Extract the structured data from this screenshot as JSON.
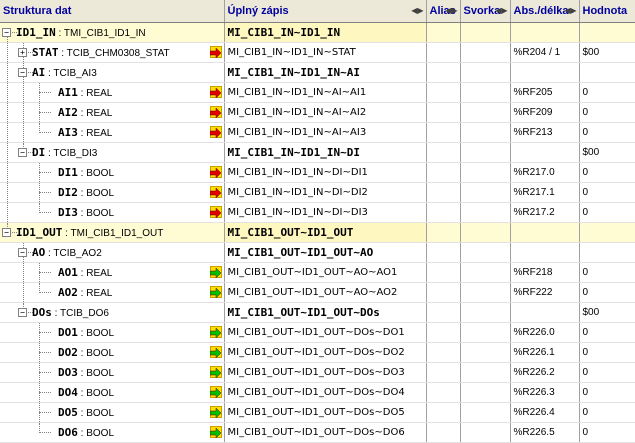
{
  "columns": {
    "structure": "Struktura dat",
    "full_path": "Úplný zápis",
    "alias": "Alias",
    "terminal": "Svorka",
    "abs_len": "Abs./délka",
    "value": "Hodnota"
  },
  "rows": [
    {
      "level": 0,
      "expander": "minus",
      "name": "ID1_IN",
      "sep": " : ",
      "type": "TMI_CIB1_ID1_IN",
      "full": "MI_CIB1_IN~ID1_IN",
      "bold": true,
      "highlight": true,
      "pin": "",
      "abs": "",
      "val": ""
    },
    {
      "level": 1,
      "expander": "plus",
      "name": "STAT",
      "sep": " : ",
      "type": "TCIB_CHM0308_STAT",
      "full": "MI_CIB1_IN~ID1_IN~STAT",
      "bold": false,
      "highlight": false,
      "pin": "in",
      "abs": "%R204 / 1",
      "val": "$00"
    },
    {
      "level": 1,
      "expander": "minus",
      "name": "AI",
      "sep": " : ",
      "type": "TCIB_AI3",
      "full": "MI_CIB1_IN~ID1_IN~AI",
      "bold": true,
      "highlight": false,
      "pin": "",
      "abs": "",
      "val": ""
    },
    {
      "level": 2,
      "expander": "",
      "name": "AI1",
      "sep": " : ",
      "type": "REAL",
      "full": "MI_CIB1_IN~ID1_IN~AI~AI1",
      "bold": false,
      "highlight": false,
      "pin": "in",
      "abs": "%RF205",
      "val": "0"
    },
    {
      "level": 2,
      "expander": "",
      "name": "AI2",
      "sep": " : ",
      "type": "REAL",
      "full": "MI_CIB1_IN~ID1_IN~AI~AI2",
      "bold": false,
      "highlight": false,
      "pin": "in",
      "abs": "%RF209",
      "val": "0"
    },
    {
      "level": 2,
      "expander": "",
      "name": "AI3",
      "sep": " : ",
      "type": "REAL",
      "full": "MI_CIB1_IN~ID1_IN~AI~AI3",
      "bold": false,
      "highlight": false,
      "pin": "in",
      "abs": "%RF213",
      "val": "0"
    },
    {
      "level": 1,
      "expander": "minus",
      "name": "DI",
      "sep": " : ",
      "type": "TCIB_DI3",
      "full": "MI_CIB1_IN~ID1_IN~DI",
      "bold": true,
      "highlight": false,
      "pin": "",
      "abs": "",
      "val": "$00"
    },
    {
      "level": 2,
      "expander": "",
      "name": "DI1",
      "sep": " : ",
      "type": "BOOL",
      "full": "MI_CIB1_IN~ID1_IN~DI~DI1",
      "bold": false,
      "highlight": false,
      "pin": "in",
      "abs": "%R217.0",
      "val": "0"
    },
    {
      "level": 2,
      "expander": "",
      "name": "DI2",
      "sep": " : ",
      "type": "BOOL",
      "full": "MI_CIB1_IN~ID1_IN~DI~DI2",
      "bold": false,
      "highlight": false,
      "pin": "in",
      "abs": "%R217.1",
      "val": "0"
    },
    {
      "level": 2,
      "expander": "",
      "name": "DI3",
      "sep": " : ",
      "type": "BOOL",
      "full": "MI_CIB1_IN~ID1_IN~DI~DI3",
      "bold": false,
      "highlight": false,
      "pin": "in",
      "abs": "%R217.2",
      "val": "0"
    },
    {
      "level": 0,
      "expander": "minus",
      "name": "ID1_OUT",
      "sep": " : ",
      "type": "TMI_CIB1_ID1_OUT",
      "full": "MI_CIB1_OUT~ID1_OUT",
      "bold": true,
      "highlight": true,
      "pin": "",
      "abs": "",
      "val": ""
    },
    {
      "level": 1,
      "expander": "minus",
      "name": "AO",
      "sep": " : ",
      "type": "TCIB_AO2",
      "full": "MI_CIB1_OUT~ID1_OUT~AO",
      "bold": true,
      "highlight": false,
      "pin": "",
      "abs": "",
      "val": ""
    },
    {
      "level": 2,
      "expander": "",
      "name": "AO1",
      "sep": " : ",
      "type": "REAL",
      "full": "MI_CIB1_OUT~ID1_OUT~AO~AO1",
      "bold": false,
      "highlight": false,
      "pin": "out",
      "abs": "%RF218",
      "val": "0"
    },
    {
      "level": 2,
      "expander": "",
      "name": "AO2",
      "sep": " : ",
      "type": "REAL",
      "full": "MI_CIB1_OUT~ID1_OUT~AO~AO2",
      "bold": false,
      "highlight": false,
      "pin": "out",
      "abs": "%RF222",
      "val": "0"
    },
    {
      "level": 1,
      "expander": "minus",
      "name": "DOs",
      "sep": " : ",
      "type": "TCIB_DO6",
      "full": "MI_CIB1_OUT~ID1_OUT~DOs",
      "bold": true,
      "highlight": false,
      "pin": "",
      "abs": "",
      "val": "$00"
    },
    {
      "level": 2,
      "expander": "",
      "name": "DO1",
      "sep": " : ",
      "type": "BOOL",
      "full": "MI_CIB1_OUT~ID1_OUT~DOs~DO1",
      "bold": false,
      "highlight": false,
      "pin": "out",
      "abs": "%R226.0",
      "val": "0"
    },
    {
      "level": 2,
      "expander": "",
      "name": "DO2",
      "sep": " : ",
      "type": "BOOL",
      "full": "MI_CIB1_OUT~ID1_OUT~DOs~DO2",
      "bold": false,
      "highlight": false,
      "pin": "out",
      "abs": "%R226.1",
      "val": "0"
    },
    {
      "level": 2,
      "expander": "",
      "name": "DO3",
      "sep": " : ",
      "type": "BOOL",
      "full": "MI_CIB1_OUT~ID1_OUT~DOs~DO3",
      "bold": false,
      "highlight": false,
      "pin": "out",
      "abs": "%R226.2",
      "val": "0"
    },
    {
      "level": 2,
      "expander": "",
      "name": "DO4",
      "sep": " : ",
      "type": "BOOL",
      "full": "MI_CIB1_OUT~ID1_OUT~DOs~DO4",
      "bold": false,
      "highlight": false,
      "pin": "out",
      "abs": "%R226.3",
      "val": "0"
    },
    {
      "level": 2,
      "expander": "",
      "name": "DO5",
      "sep": " : ",
      "type": "BOOL",
      "full": "MI_CIB1_OUT~ID1_OUT~DOs~DO5",
      "bold": false,
      "highlight": false,
      "pin": "out",
      "abs": "%R226.4",
      "val": "0"
    },
    {
      "level": 2,
      "expander": "",
      "name": "DO6",
      "sep": " : ",
      "type": "BOOL",
      "full": "MI_CIB1_OUT~ID1_OUT~DOs~DO6",
      "bold": false,
      "highlight": false,
      "pin": "out",
      "abs": "%R226.5",
      "val": "0"
    }
  ],
  "colors": {
    "header_text": "#0000a0",
    "highlight_row": "#fffcd4",
    "pin_yellow": "#ffe000",
    "pin_in_arrow": "#e00000",
    "pin_out_arrow": "#00c000"
  },
  "icons": {
    "input_pin": "red-arrow-pin-icon",
    "output_pin": "green-arrow-pin-icon",
    "expand": "plus-box-icon",
    "collapse": "minus-box-icon"
  }
}
